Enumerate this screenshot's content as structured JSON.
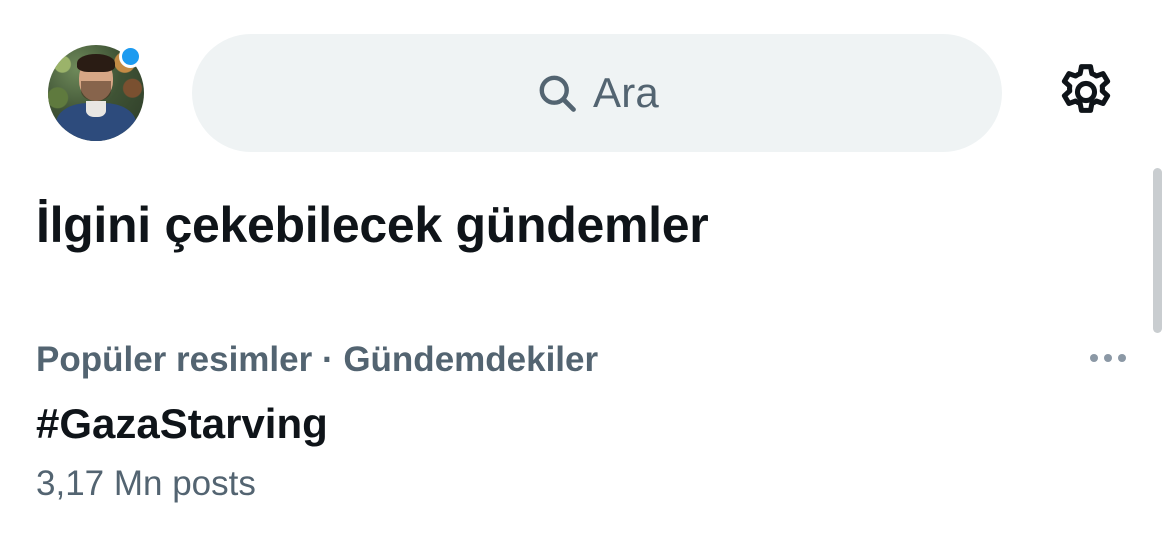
{
  "header": {
    "avatar_alt": "profile photo",
    "has_notification": true,
    "search": {
      "placeholder": "Ara"
    },
    "settings_icon": "gear-icon"
  },
  "section": {
    "title": "İlgini çekebilecek gündemler"
  },
  "trends": [
    {
      "context": "Popüler resimler · Gündemdekiler",
      "name": "#GazaStarving",
      "count": "3,17 Mn posts"
    }
  ],
  "icons": {
    "search": "search-icon",
    "settings": "gear-icon",
    "more": "more-horizontal-icon"
  },
  "colors": {
    "accent": "#1d9bf0",
    "search_bg": "#eff3f4",
    "primary_text": "#0f1419",
    "secondary_text": "#536471"
  }
}
